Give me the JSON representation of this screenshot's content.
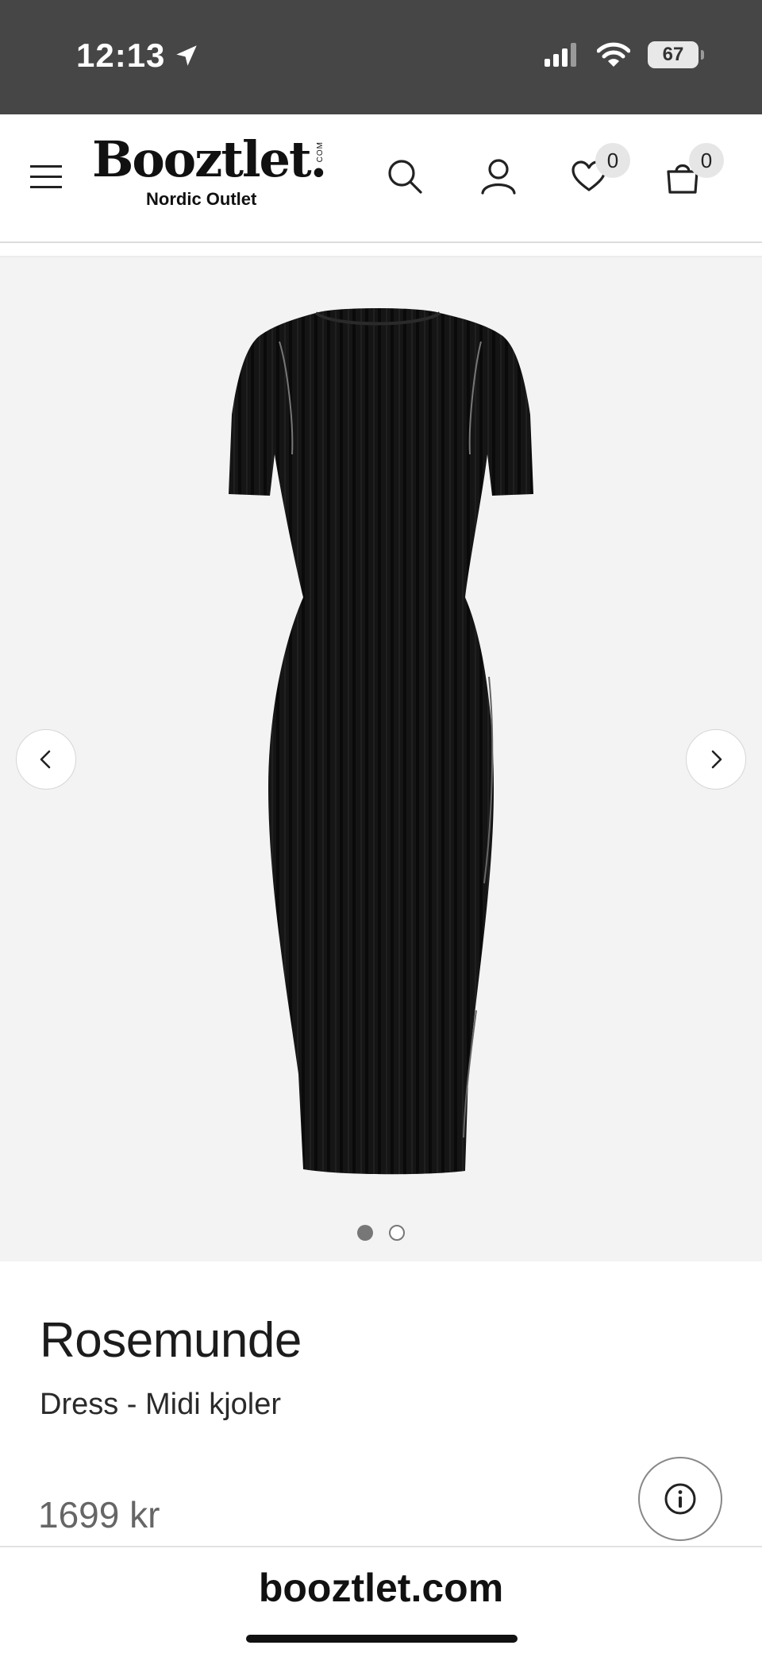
{
  "status_bar": {
    "time": "12:13",
    "battery": "67"
  },
  "header": {
    "logo": "Booztlet.",
    "logo_com": "COM",
    "logo_subtitle": "Nordic Outlet",
    "wishlist_count": "0",
    "cart_count": "0"
  },
  "gallery": {
    "slide_count": 2,
    "active_slide": 1
  },
  "product": {
    "brand": "Rosemunde",
    "subtitle": "Dress - Midi kjoler",
    "price": "1699 kr"
  },
  "browser": {
    "url": "booztlet.com"
  },
  "colors": {
    "status_bar_bg": "#464646",
    "gallery_bg": "#f3f3f3",
    "dress": "#111111",
    "price": "#666666"
  },
  "icons": [
    "menu-icon",
    "search-icon",
    "user-icon",
    "heart-icon",
    "bag-icon",
    "chevron-left-icon",
    "chevron-right-icon",
    "info-icon",
    "location-arrow-icon",
    "signal-icon",
    "wifi-icon"
  ]
}
